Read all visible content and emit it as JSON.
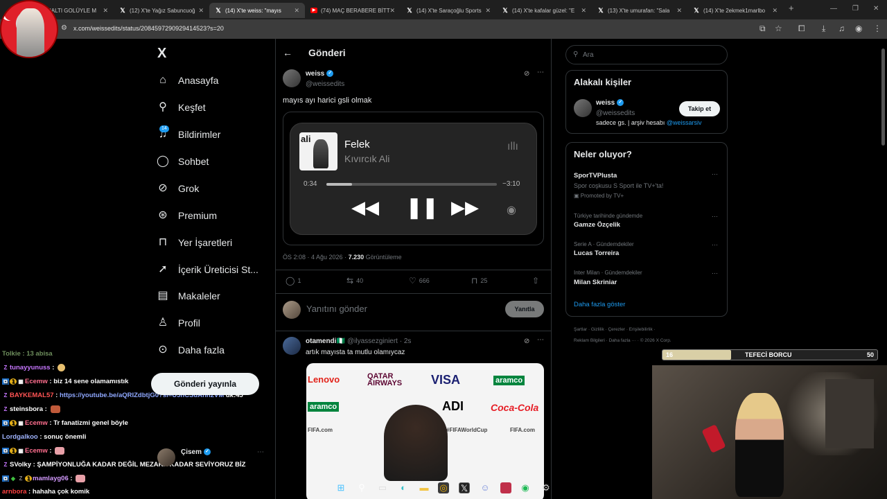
{
  "browser": {
    "tabs": [
      {
        "label": "NALTI GOLÜYLE M",
        "icon": "x-icon"
      },
      {
        "label": "(12) X'te Yağız Sabuncuoğ",
        "icon": "x-icon"
      },
      {
        "label": "(14) X'te weiss: \"mayıs",
        "icon": "x-icon",
        "active": true
      },
      {
        "label": "(74) MAÇ BERABERE BİTTİ",
        "icon": "youtube-icon"
      },
      {
        "label": "(14) X'te Saraçoğlu Sports",
        "icon": "x-icon"
      },
      {
        "label": "(14) X'te kafalar güzel: \"E",
        "icon": "x-icon"
      },
      {
        "label": "(13) X'te umurafan: \"Sala",
        "icon": "x-icon"
      },
      {
        "label": "(14) X'te 2ekmek1marlbo",
        "icon": "x-icon"
      }
    ],
    "new_tab": "+",
    "url": "x.com/weissedits/status/2084597290929414523?s=20"
  },
  "nav": {
    "logo": "X",
    "items": [
      {
        "label": "Anasayfa",
        "icon": "home-icon",
        "glyph": "⌂"
      },
      {
        "label": "Keşfet",
        "icon": "search-icon",
        "glyph": "⌕"
      },
      {
        "label": "Bildirimler",
        "icon": "bell-icon",
        "glyph": "🔔"
      },
      {
        "label": "Sohbet",
        "icon": "chat-icon",
        "glyph": "◯"
      },
      {
        "label": "Grok",
        "icon": "grok-icon",
        "glyph": "⊘"
      },
      {
        "label": "Premium",
        "icon": "premium-icon",
        "glyph": "✓"
      },
      {
        "label": "Yer İşaretleri",
        "icon": "bookmark-icon",
        "glyph": "⊓"
      },
      {
        "label": "İçerik Üreticisi St...",
        "icon": "rocket-icon",
        "glyph": "➚"
      },
      {
        "label": "Makaleler",
        "icon": "article-icon",
        "glyph": "▤"
      },
      {
        "label": "Profil",
        "icon": "person-icon",
        "glyph": "♙"
      },
      {
        "label": "Daha fazla",
        "icon": "more-icon",
        "glyph": "⋯"
      }
    ],
    "notif_badge": "14",
    "post_button": "Gönderi yayınla"
  },
  "post": {
    "header_title": "Gönderi",
    "author_name": "weiss",
    "author_handle": "@weissedits",
    "text": "mayıs ayı harici gsli olmak",
    "player": {
      "album_text": "ali",
      "song": "Felek",
      "artist": "Kıvırcık Ali",
      "elapsed": "0:34",
      "remaining": "−3:10",
      "progress": 0.15
    },
    "time": "ÖS 2:08 · 4 Ağu 2026 · ",
    "views": "7.230",
    "views_label": " Görüntüleme",
    "replies": "1",
    "reposts": "40",
    "likes": "666",
    "bookmarks": "25",
    "reply_placeholder": "Yanıtını gönder",
    "reply_button": "Yanıtla"
  },
  "reply_tweet": {
    "author": "otamendi🇳🇬",
    "handle": "@ilyassezginiert · 2s",
    "text": "artık mayısta ta mutlu olamıycaz",
    "sponsors": [
      "Lenovo",
      "QATAR AIRWAYS",
      "VISA",
      "aramco",
      "aramco",
      "ADI",
      "Coca-Cola",
      "FIFA.com",
      "#FIFAWorldCup",
      "FIFA.com"
    ]
  },
  "right": {
    "search_placeholder": "Ara",
    "related_title": "Alakalı kişiler",
    "related_name": "weiss",
    "related_handle": "@weissedits",
    "follow": "Takip et",
    "bio": "sadece gs. | arşiv hesabı ",
    "bio_link": "@weissarsiv",
    "trends_title": "Neler oluyor?",
    "trends": [
      {
        "sub": "",
        "main": "SporTVPlusta",
        "desc": "Spor coşkusu S Sport ile TV+'ta!",
        "promo": "Promoted by TV+"
      },
      {
        "sub": "Türkiye tarihinde gündemde",
        "main": "Gamze Özçelik"
      },
      {
        "sub": "Serie A · Gündemdekiler",
        "main": "Lucas Torreira"
      },
      {
        "sub": "Inter Milan · Gündemdekiler",
        "main": "Milan Skriniar"
      }
    ],
    "more": "Daha fazla göster",
    "footer1": "Şartlar  ·  Gizlilik  ·  Çerezler  ·  Erişilebilirlik  ·",
    "footer2": "Reklam Bilgileri  ·  Daha fazla ···  ·  © 2026 X Corp."
  },
  "stream": {
    "borcu_left": "16",
    "borcu_label": "TEFECİ BORCU",
    "borcu_right": "50",
    "borcu_fill": 0.32,
    "chat": [
      {
        "user": "Tolkie : 13 abisa",
        "msg": "",
        "color": "#6e8f5d"
      },
      {
        "user": "tunayyunuss",
        "msg": " : ",
        "color": "#c777ff"
      },
      {
        "user": "Ecemw",
        "msg": " : biz 14 sene olamamıstık",
        "color": "#ff6f8f"
      },
      {
        "user": "BAYKEMAL57",
        "msg": " : ",
        "link": "https://youtube.be/aQRIZdbtjG0?si=U5hCSuAnh2VM",
        "tail": "dk:45",
        "color": "#ff5454"
      },
      {
        "user": "steinsbora",
        "msg": " : ",
        "color": "#ffffff"
      },
      {
        "user": "Ecemw",
        "msg": " : Tr fanatizmi genel böyle",
        "color": "#ff6f8f"
      },
      {
        "user": "Lordgalkoo",
        "msg": " : sonuç önemli",
        "color": "#a0b4ff"
      },
      {
        "user": "Ecemw",
        "msg": " : ",
        "color": "#ff6f8f"
      },
      {
        "user": "SVolky",
        "msg": " : ŞAMPİYONLUĞA KADAR DEĞİL MEZARA KADAR SEVİYORUZ BİZ",
        "color": "#ffffff"
      },
      {
        "user": "mamlayg06",
        "msg": " : ",
        "color": "#d49aff"
      },
      {
        "user": "arnbora",
        "msg": " : hahaha çok komik",
        "color": "#ff4040"
      }
    ],
    "mini_user": "Çisem"
  }
}
